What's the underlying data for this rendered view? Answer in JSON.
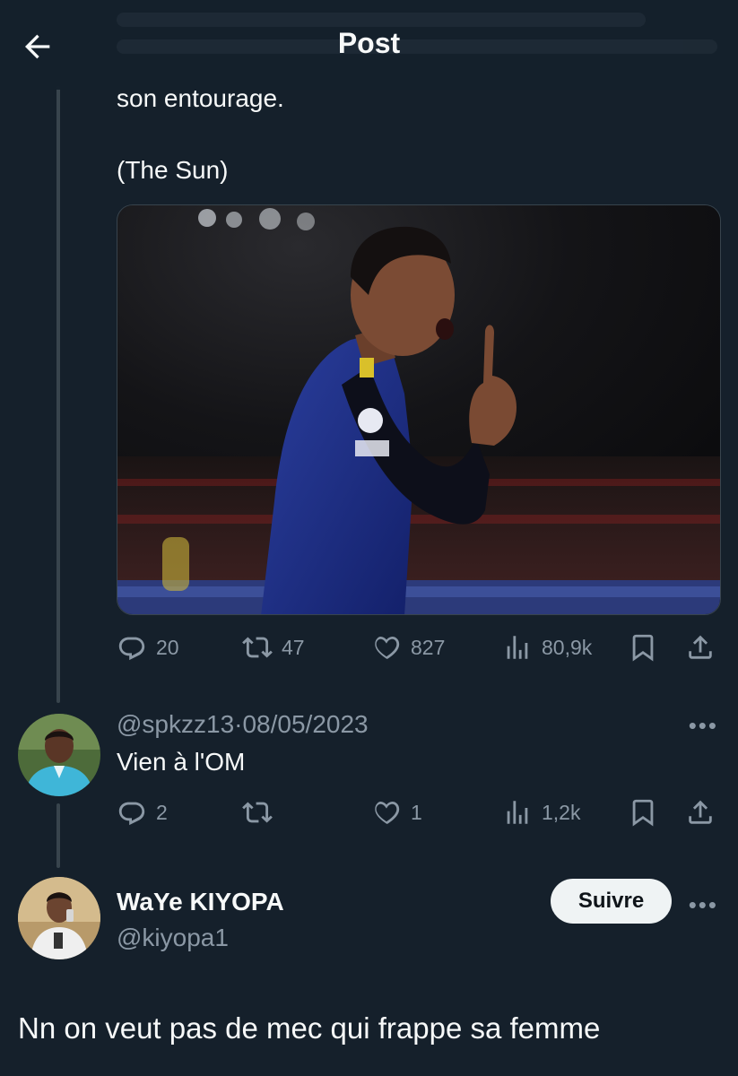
{
  "header": {
    "title": "Post"
  },
  "tweet": {
    "text_line1": "son entourage.",
    "text_line2": "(The Sun)",
    "stats": {
      "replies": "20",
      "reposts": "47",
      "likes": "827",
      "views": "80,9k"
    }
  },
  "reply": {
    "handle": "@spkzz13",
    "separator": "·",
    "date": "08/05/2023",
    "text": "Vien à l'OM",
    "stats": {
      "replies": "2",
      "reposts": "",
      "likes": "1",
      "views": "1,2k"
    }
  },
  "focus_post": {
    "name": "WaYe KIYOPA",
    "handle": "@kiyopa1",
    "follow_label": "Suivre",
    "text": "Nn on veut pas de mec qui frappe sa femme"
  },
  "more_label": "•••",
  "icons": [
    "back-arrow-icon",
    "reply-icon",
    "repost-icon",
    "like-icon",
    "views-icon",
    "bookmark-icon",
    "share-icon",
    "more-icon"
  ],
  "colors": {
    "background": "#15202b",
    "text_primary": "#f7f9f9",
    "text_secondary": "#8b98a5",
    "divider": "#38444d",
    "follow_bg": "#eff3f4"
  }
}
